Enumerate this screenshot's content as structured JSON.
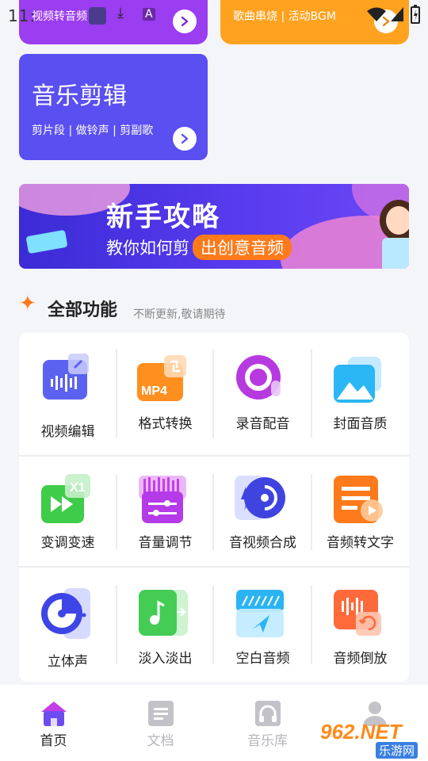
{
  "status_bar": {
    "time": "11:",
    "icons": [
      "download-icon",
      "a-icon",
      "wifi-icon",
      "signal-icon",
      "battery-icon"
    ]
  },
  "top_cards": [
    {
      "subtitle": "视频转音频",
      "color": "#9b3df0"
    },
    {
      "subtitle": "歌曲串烧 | 活动BGM",
      "color": "#ffa21f"
    }
  ],
  "edit_card": {
    "title": "音乐剪辑",
    "subtitle": "剪片段 | 做铃声 | 剪副歌",
    "color": "#5a4ff0"
  },
  "banner": {
    "title": "新手攻略",
    "line": "教你如何剪",
    "highlight": "出创意音频"
  },
  "section": {
    "title": "全部功能",
    "hint": "不断更新,敬请期待"
  },
  "features": [
    {
      "label": "视频编辑",
      "icon": "video-edit-icon"
    },
    {
      "label": "格式转换",
      "icon": "mp4-format-icon"
    },
    {
      "label": "录音配音",
      "icon": "record-icon"
    },
    {
      "label": "封面音质",
      "icon": "cover-image-icon"
    },
    {
      "label": "变调变速",
      "icon": "speed-x1-icon"
    },
    {
      "label": "音量调节",
      "icon": "volume-adjust-icon"
    },
    {
      "label": "音视频合成",
      "icon": "av-merge-icon"
    },
    {
      "label": "音频转文字",
      "icon": "audio-to-text-icon"
    },
    {
      "label": "立体声",
      "icon": "stereo-icon"
    },
    {
      "label": "淡入淡出",
      "icon": "fade-in-out-icon"
    },
    {
      "label": "空白音频",
      "icon": "blank-audio-icon"
    },
    {
      "label": "音频倒放",
      "icon": "reverse-audio-icon"
    }
  ],
  "nav": [
    {
      "label": "首页",
      "icon": "home-icon",
      "active": true
    },
    {
      "label": "文档",
      "icon": "document-icon",
      "active": false
    },
    {
      "label": "音乐库",
      "icon": "headphones-icon",
      "active": false
    },
    {
      "label": "",
      "icon": "profile-icon",
      "active": false
    }
  ],
  "watermark": {
    "brand": "962.NET",
    "sub": "乐游网"
  }
}
